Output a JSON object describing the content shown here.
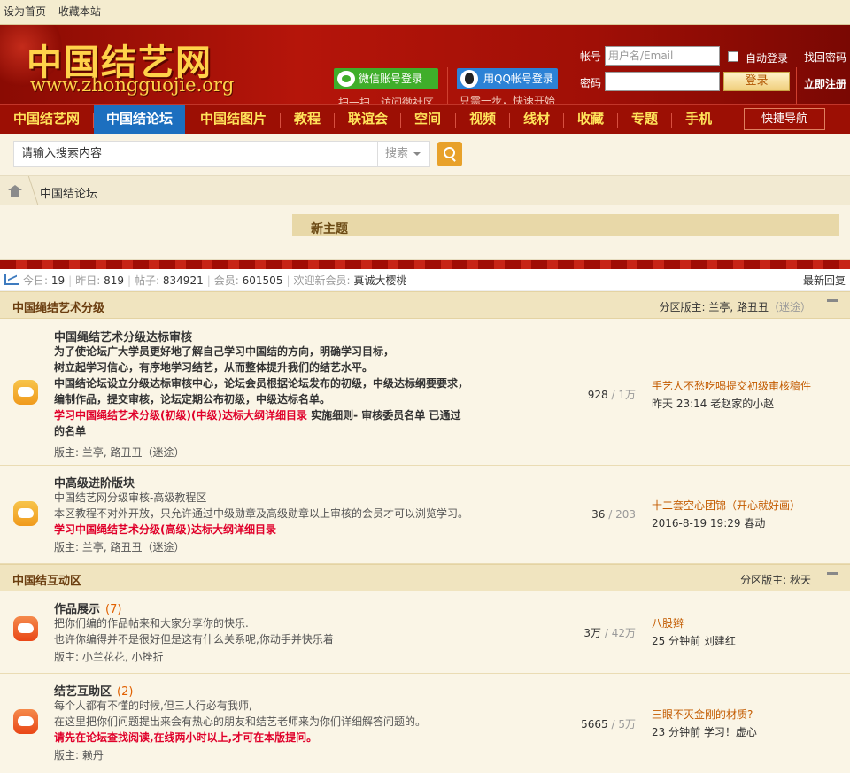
{
  "topbar": {
    "set_home": "设为首页",
    "favorite": "收藏本站"
  },
  "header": {
    "logo_zh": "中国结艺网",
    "logo_en": "www.zhongguojie.org",
    "wechat_login": "微信账号登录",
    "wechat_sub": "扫一扫，访问微社区",
    "qq_login": "用QQ帐号登录",
    "qq_sub": "只需一步，快速开始",
    "account_label": "帐号",
    "account_placeholder": "用户名/Email",
    "password_label": "密码",
    "auto_login": "自动登录",
    "login_button": "登录",
    "find_password": "找回密码",
    "register": "立即注册"
  },
  "nav": {
    "items": [
      "中国结艺网",
      "中国结论坛",
      "中国结图片",
      "教程",
      "联谊会",
      "空间",
      "视频",
      "线材",
      "收藏",
      "专题",
      "手机"
    ],
    "active": "中国结论坛",
    "quick_nav": "快捷导航"
  },
  "search": {
    "placeholder": "请输入搜索内容",
    "type": "搜索"
  },
  "breadcrumb": {
    "current": "中国结论坛"
  },
  "new_topic": "新主题",
  "stats": {
    "today_label": "今日:",
    "today": "19",
    "yesterday_label": "昨日:",
    "yesterday": "819",
    "posts_label": "帖子:",
    "posts": "834921",
    "members_label": "会员:",
    "members": "601505",
    "welcome_label": "欢迎新会员:",
    "welcome": "真诚大樱桃",
    "latest": "最新回复"
  },
  "groups": [
    {
      "title": "中国绳结艺术分级",
      "mods_label": "分区版主:",
      "mods": "兰亭, 路丑丑",
      "mods_extra": "（迷途）",
      "forums": [
        {
          "name": "中国绳结艺术分级达标审核",
          "desc": [
            "为了使论坛广大学员更好地了解自己学习中国结的方向，明确学习目标，",
            "树立起学习信心，有序地学习结艺，从而整体提升我们的结艺水平。",
            "中国结论坛设立分级达标审核中心，论坛会员根据论坛发布的初级，中级达标纲要要求，",
            "编制作品，提交审核，论坛定期公布初级，中级达标名单。"
          ],
          "link_red": "学习中国绳结艺术分级(初级)(中级)达标大纲详细目录",
          "link_black": " 实施细则- 审核委员名单  已通过",
          "link_black2": "的名单",
          "mods": "版主: 兰亭, 路丑丑（迷途）",
          "threads": "928",
          "posts": "1万",
          "last_title": "手艺人不愁吃喝提交初级审核稿件",
          "last_time": "昨天 23:14",
          "last_user": "老赵家的小赵"
        },
        {
          "name": "中高级进阶版块",
          "desc": [
            "中国结艺网分级审核-高级教程区",
            "本区教程不对外开放，只允许通过中级勋章及高级勋章以上审核的会员才可以浏览学习。"
          ],
          "link_red": "学习中国绳结艺术分级(高级)达标大纲详细目录",
          "mods": "版主: 兰亭, 路丑丑（迷途）",
          "threads": "36",
          "posts": "203",
          "last_title": "十二套空心团锦（开心就好画）",
          "last_time": "2016-8-19 19:29",
          "last_user": "春动"
        }
      ]
    },
    {
      "title": "中国结互动区",
      "mods_label": "分区版主:",
      "mods": "秋天",
      "forums": [
        {
          "name": "作品展示",
          "count": "(7)",
          "desc": [
            "把你们编的作品帖来和大家分享你的快乐.",
            "也许你编得并不是很好但是这有什么关系呢,你动手并快乐着"
          ],
          "mods": "版主: 小兰花花, 小挫折",
          "threads": "3万",
          "posts": "42万",
          "last_title": "八股辫",
          "last_time": "25 分钟前",
          "last_user": "刘建红"
        },
        {
          "name": "结艺互助区",
          "count": "(2)",
          "desc": [
            "每个人都有不懂的时候,但三人行必有我师,",
            "在这里把你们问题提出来会有热心的朋友和结艺老师来为你们详细解答问题的。"
          ],
          "link_red": "请先在论坛查找阅读,在线两小时以上,才可在本版提问。",
          "mods": "版主: 赖丹",
          "threads": "5665",
          "posts": "5万",
          "last_title": "三眼不灭金刚的材质?",
          "last_time": "23 分钟前",
          "last_user": "学习！虚心"
        }
      ]
    }
  ],
  "colors": {
    "nav_bg": "#9c0f04",
    "nav_text": "#ffe35a",
    "nav_active": "#1c6fbf",
    "accent_red": "#e0002a",
    "group_header": "#f0e4bf"
  },
  "icons": [
    "wechat-icon",
    "qq-icon",
    "search-icon",
    "home-icon",
    "stats-chart-icon",
    "collapse-icon",
    "forum-icon"
  ]
}
